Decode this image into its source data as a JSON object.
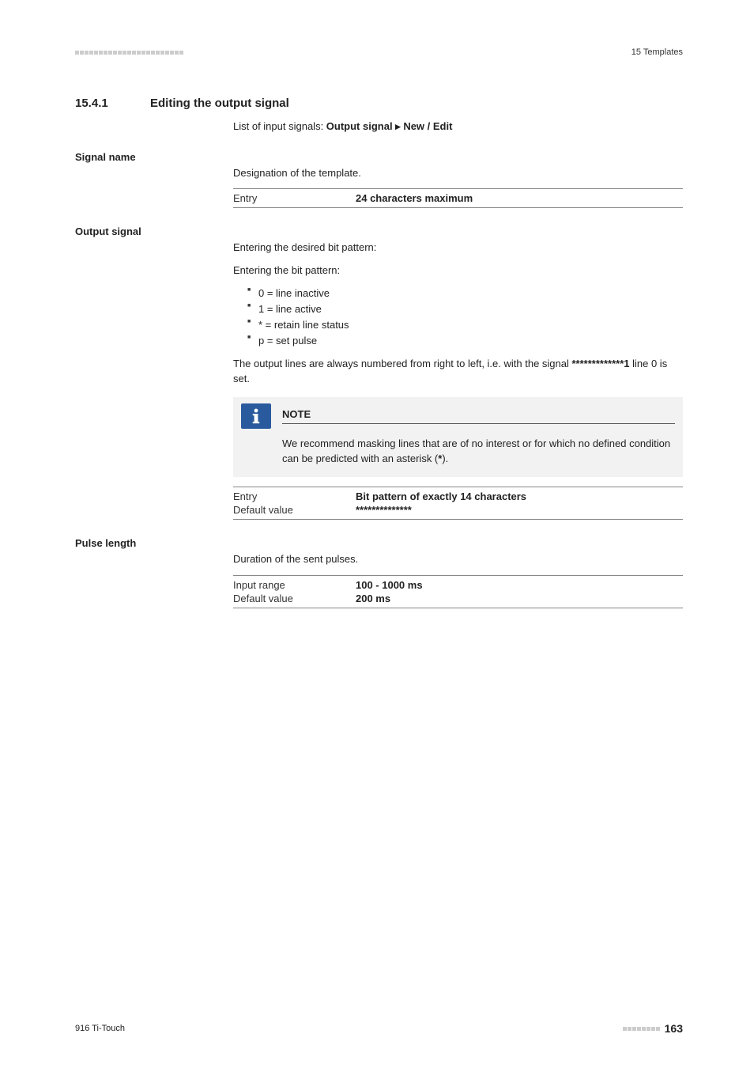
{
  "header": {
    "label": "15 Templates"
  },
  "section": {
    "number": "15.4.1",
    "title": "Editing the output signal"
  },
  "intro": {
    "prefix": "List of input signals: ",
    "bold": "Output signal ▸ New / Edit"
  },
  "signal_name": {
    "label": "Signal name",
    "desc": "Designation of the template.",
    "entry_key": "Entry",
    "entry_val": "24 characters maximum"
  },
  "output_signal": {
    "label": "Output signal",
    "desc1": "Entering the desired bit pattern:",
    "desc2": "Entering the bit pattern:",
    "bullets": [
      "0 = line inactive",
      "1 = line active",
      "* = retain line status",
      "p = set pulse"
    ],
    "after_prefix": "The output lines are always numbered from right to left, i.e. with the signal ",
    "after_bold": "*************1",
    "after_suffix": " line 0 is set.",
    "note_label": "NOTE",
    "note_text_prefix": "We recommend masking lines that are of no interest or for which no defined condition can be predicted with an asterisk (",
    "note_text_bold": "*",
    "note_text_suffix": ").",
    "entry_key": "Entry",
    "entry_val": "Bit pattern of exactly 14 characters",
    "default_key": "Default value",
    "default_val": "**************"
  },
  "pulse_length": {
    "label": "Pulse length",
    "desc": "Duration of the sent pulses.",
    "range_key": "Input range",
    "range_val": "100 - 1000 ms",
    "default_key": "Default value",
    "default_val": "200 ms"
  },
  "footer": {
    "left": "916 Ti-Touch",
    "page": "163"
  }
}
